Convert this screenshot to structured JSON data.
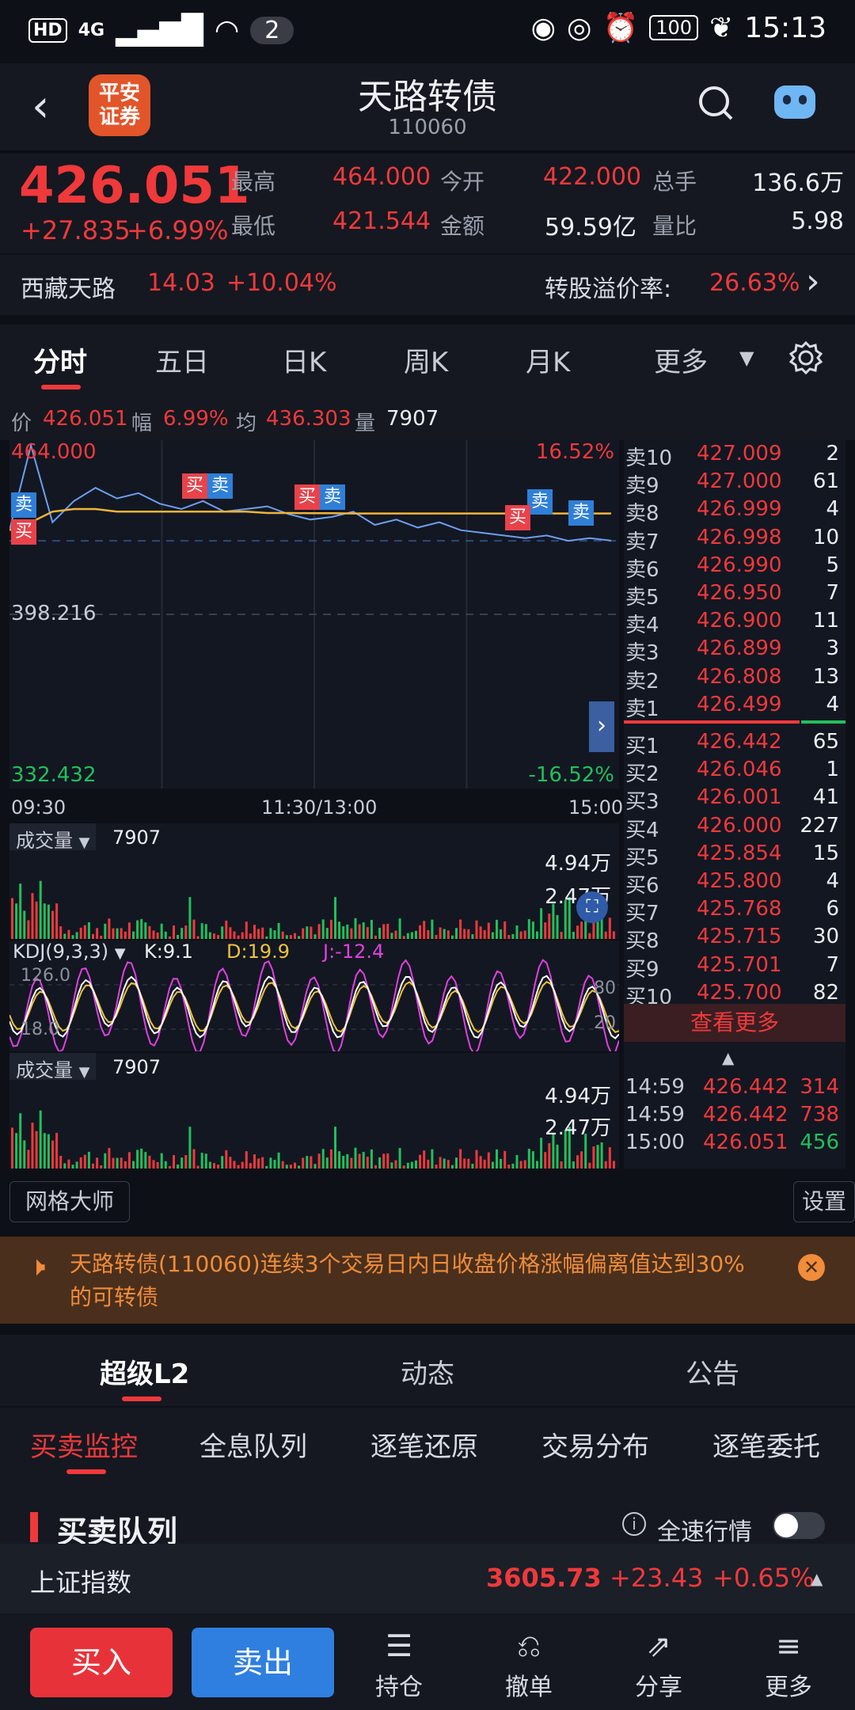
{
  "status": {
    "network": "4G",
    "notifications": "2",
    "battery": "100",
    "time": "15:13"
  },
  "header": {
    "broker_logo": "平安\n证券",
    "title": "天路转债",
    "code": "110060"
  },
  "quote": {
    "price": "426.051",
    "change": "+27.835",
    "pct": "+6.99%",
    "high_label": "最高",
    "high": "464.000",
    "low_label": "最低",
    "low": "421.544",
    "open_label": "今开",
    "open": "422.000",
    "amount_label": "金额",
    "amount": "59.59亿",
    "vol_label": "总手",
    "vol": "136.6万",
    "ratio_label": "量比",
    "ratio": "5.98"
  },
  "sub": {
    "stock": "西藏天路",
    "stock_price": "14.03",
    "stock_pct": "+10.04%",
    "premium_label": "转股溢价率:",
    "premium": "26.63%"
  },
  "ktabs": [
    "分时",
    "五日",
    "日K",
    "周K",
    "月K",
    "更多"
  ],
  "info": {
    "price_l": "价",
    "price": "426.051",
    "amp_l": "幅",
    "amp": "6.99%",
    "avg_l": "均",
    "avg": "436.303",
    "vol_l": "量",
    "vol": "7907"
  },
  "chart": {
    "top": "464.000",
    "mid": "398.216",
    "bottom": "332.432",
    "top_pct": "16.52%",
    "bottom_pct": "-16.52%",
    "t1": "09:30",
    "t2": "11:30/13:00",
    "t3": "15:00",
    "buy": "买",
    "sell": "卖"
  },
  "chart_data": {
    "type": "line",
    "title": "",
    "x_labels": [
      "09:30",
      "11:30/13:00",
      "15:00"
    ],
    "ylim": [
      332.432,
      464.0
    ],
    "prev_close": 398.216,
    "series": [
      {
        "values": [
          430,
          462,
          433,
          441,
          446,
          442,
          444,
          440,
          438,
          441,
          437,
          438,
          439,
          436,
          434,
          435,
          437,
          432,
          434,
          431,
          433,
          430,
          429,
          428,
          427,
          428,
          426,
          427,
          426.051
        ]
      },
      {
        "values": [
          430,
          433,
          437,
          438,
          438,
          437,
          437,
          437,
          437,
          437,
          437,
          437,
          436.5,
          436.5,
          436.4,
          436.4,
          436.3,
          436.3,
          436.3,
          436.3,
          436.3,
          436.3,
          436.3,
          436.3,
          436.3,
          436.3,
          436.3,
          436.3,
          436.303
        ]
      }
    ]
  },
  "vol1": {
    "label": "成交量",
    "value": "7907",
    "max": "4.94万",
    "mid": "2.47万"
  },
  "kdj": {
    "label": "KDJ(9,3,3)",
    "k": "K:9.1",
    "d": "D:19.9",
    "j": "J:-12.4",
    "top": "126.0",
    "low": "18.0",
    "r80": "80",
    "r20": "20"
  },
  "vol2": {
    "label": "成交量",
    "value": "7907",
    "max": "4.94万",
    "mid": "2.47万"
  },
  "book": {
    "asks": [
      [
        "卖10",
        "427.009",
        "2"
      ],
      [
        "卖9",
        "427.000",
        "61"
      ],
      [
        "卖8",
        "426.999",
        "4"
      ],
      [
        "卖7",
        "426.998",
        "10"
      ],
      [
        "卖6",
        "426.990",
        "5"
      ],
      [
        "卖5",
        "426.950",
        "7"
      ],
      [
        "卖4",
        "426.900",
        "11"
      ],
      [
        "卖3",
        "426.899",
        "3"
      ],
      [
        "卖2",
        "426.808",
        "13"
      ],
      [
        "卖1",
        "426.499",
        "4"
      ]
    ],
    "bids": [
      [
        "买1",
        "426.442",
        "65"
      ],
      [
        "买2",
        "426.046",
        "1"
      ],
      [
        "买3",
        "426.001",
        "41"
      ],
      [
        "买4",
        "426.000",
        "227"
      ],
      [
        "买5",
        "425.854",
        "15"
      ],
      [
        "买6",
        "425.800",
        "4"
      ],
      [
        "买7",
        "425.768",
        "6"
      ],
      [
        "买8",
        "425.715",
        "30"
      ],
      [
        "买9",
        "425.701",
        "7"
      ],
      [
        "买10",
        "425.700",
        "82"
      ]
    ],
    "more": "查看更多",
    "ticks": [
      [
        "14:59",
        "426.442",
        "314"
      ],
      [
        "14:59",
        "426.442",
        "738"
      ],
      [
        "15:00",
        "426.051",
        "456"
      ]
    ]
  },
  "tools": {
    "grid": "网格大师",
    "settings": "设置"
  },
  "alert": {
    "text": "天路转债(110060)连续3个交易日内日收盘价格涨幅偏离值达到30%的可转债"
  },
  "tabs2": [
    "超级L2",
    "动态",
    "公告"
  ],
  "tabs3": [
    "买卖监控",
    "全息队列",
    "逐笔还原",
    "交易分布",
    "逐笔委托"
  ],
  "queue": {
    "title": "买卖队列",
    "fast": "全速行情"
  },
  "index": {
    "name": "上证指数",
    "value": "3605.73",
    "change": "+23.43",
    "pct": "+0.65%"
  },
  "bottom": {
    "buy": "买入",
    "sell": "卖出",
    "hold": "持仓",
    "cancel": "撤单",
    "share": "分享",
    "more": "更多"
  }
}
